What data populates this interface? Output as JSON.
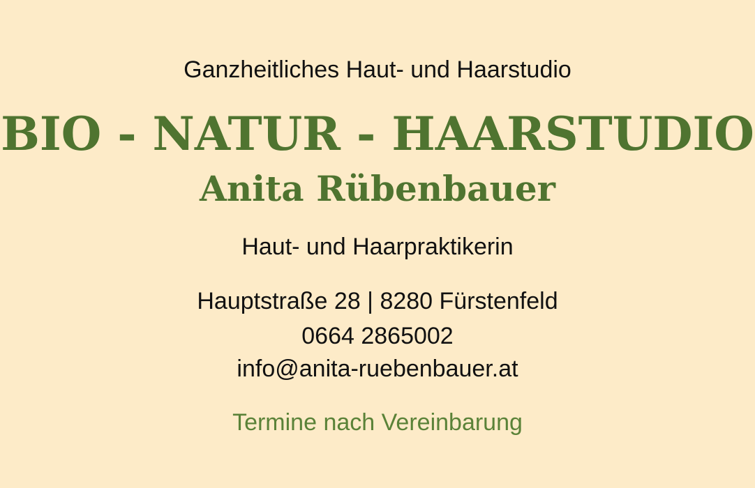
{
  "card": {
    "tagline": "Ganzheitliches Haut- und Haarstudio",
    "brand": "BIO - NATUR - HAARSTUDIO",
    "owner": "Anita Rübenbauer",
    "profession": "Haut- und Haarpraktikerin",
    "address": "Hauptstraße 28 | 8280 Fürstenfeld",
    "phone": "0664 2865002",
    "email": "info@anita-ruebenbauer.at",
    "note": "Termine nach Vereinbarung"
  },
  "colors": {
    "background": "#fdebc8",
    "accent_green": "#4f7430",
    "note_green": "#5a8238",
    "text": "#111111"
  }
}
